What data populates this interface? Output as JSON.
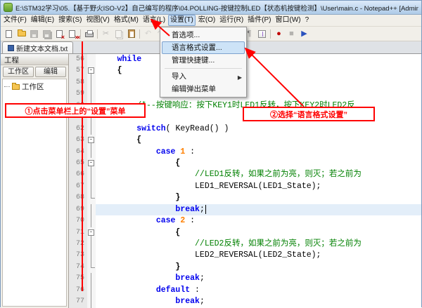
{
  "window": {
    "title": "E:\\STM32学习\\05.【基于野火ISO-V2】自己编写的程序\\04.POLLING-按键控制LED【状态机按键检测】\\User\\main.c - Notepad++ [Administrator]"
  },
  "menu_bar": {
    "active_index": 6,
    "items": [
      "文件(F)",
      "编辑(E)",
      "搜索(S)",
      "视图(V)",
      "格式(M)",
      "语言(L)",
      "设置(T)",
      "宏(O)",
      "运行(R)",
      "插件(P)",
      "窗口(W)",
      "?"
    ]
  },
  "toolbar": {
    "icons": [
      {
        "name": "new-file-icon",
        "cls": "ic-page"
      },
      {
        "name": "open-folder-icon",
        "cls": "ic-folder"
      },
      {
        "name": "save-icon",
        "cls": "ic-floppy",
        "disabled": true
      },
      {
        "name": "save-all-icon",
        "cls": "ic-floppy ic-floppy2",
        "disabled": true
      },
      {
        "name": "close-icon",
        "cls": "ic-page ic-pagex"
      },
      {
        "name": "close-all-icon",
        "cls": "ic-page ic-pagex2"
      },
      {
        "name": "toolbar-separator"
      },
      {
        "name": "print-icon",
        "cls": "ic-print"
      },
      {
        "name": "toolbar-separator"
      },
      {
        "name": "cut-icon",
        "glyph": "✂",
        "color": "#555555",
        "disabled": true
      },
      {
        "name": "copy-icon",
        "cls": "ic-page ic-pages",
        "disabled": true
      },
      {
        "name": "paste-icon",
        "cls": "ic-paste"
      },
      {
        "name": "toolbar-separator"
      },
      {
        "name": "undo-icon",
        "glyph": "↶",
        "color": "#C8A000",
        "disabled": true
      },
      {
        "name": "redo-icon",
        "glyph": "↷",
        "color": "#8A8A8A",
        "disabled": true
      },
      {
        "name": "toolbar-separator"
      },
      {
        "name": "find-icon",
        "cls": "ic-mag"
      },
      {
        "name": "replace-icon",
        "cls": "ic-mag rep"
      },
      {
        "name": "toolbar-separator"
      },
      {
        "name": "zoom-in-icon",
        "cls": "ic-mag plus"
      },
      {
        "name": "zoom-out-icon",
        "cls": "ic-mag minus"
      },
      {
        "name": "toolbar-separator"
      },
      {
        "name": "word-wrap-icon",
        "glyph": "¶",
        "color": "#2A52BE"
      },
      {
        "name": "show-all-chars-icon",
        "glyph": "¶",
        "color": "#888888"
      },
      {
        "name": "indent-guide-icon",
        "cls": "ic-guide"
      },
      {
        "name": "toolbar-separator"
      },
      {
        "name": "record-macro-icon",
        "glyph": "●",
        "color": "#C00000"
      },
      {
        "name": "stop-macro-icon",
        "glyph": "■",
        "color": "#444444",
        "disabled": true
      },
      {
        "name": "play-macro-icon",
        "glyph": "▶",
        "color": "#2A52BE"
      }
    ]
  },
  "tab_bar": {
    "tabs": [
      {
        "label": "新建文本文档.txt"
      }
    ]
  },
  "project_panel": {
    "title": "工程",
    "workspace_button": "工作区",
    "edit_button": "编辑",
    "tree_root": "工作区"
  },
  "settings_menu": {
    "items": [
      {
        "label": "首选项..."
      },
      {
        "label": "语言格式设置...",
        "selected": true
      },
      {
        "label": "管理快捷键..."
      },
      {
        "separator": true
      },
      {
        "label": "导入",
        "submenu": true
      },
      {
        "label": "编辑弹出菜单"
      }
    ]
  },
  "editor": {
    "lines": [
      {
        "num": 56,
        "fold": "none",
        "segs": [
          {
            "t": "    "
          },
          {
            "t": "while",
            "c": "kw"
          }
        ]
      },
      {
        "num": 57,
        "fold": "box",
        "segs": [
          {
            "t": "    "
          },
          {
            "t": "{",
            "c": "op"
          }
        ]
      },
      {
        "num": 58,
        "fold": "line",
        "segs": []
      },
      {
        "num": 59,
        "fold": "line",
        "segs": []
      },
      {
        "num": 60,
        "fold": "line",
        "segs": [
          {
            "t": "        "
          },
          {
            "t": "/*--按键响应：按下KEY1时LED1反转，按下KEY2时LED2反",
            "c": "cm"
          }
        ]
      },
      {
        "num": 61,
        "fold": "line",
        "segs": []
      },
      {
        "num": 62,
        "fold": "line",
        "segs": [
          {
            "t": "        "
          },
          {
            "t": "switch",
            "c": "kw"
          },
          {
            "t": "( KeyRead() )"
          }
        ]
      },
      {
        "num": 63,
        "fold": "box",
        "segs": [
          {
            "t": "        "
          },
          {
            "t": "{",
            "c": "op"
          }
        ]
      },
      {
        "num": 64,
        "fold": "line",
        "segs": [
          {
            "t": "            "
          },
          {
            "t": "case",
            "c": "kw"
          },
          {
            "t": " "
          },
          {
            "t": "1",
            "c": "nm"
          },
          {
            "t": " :"
          }
        ]
      },
      {
        "num": 65,
        "fold": "box",
        "segs": [
          {
            "t": "                "
          },
          {
            "t": "{",
            "c": "op"
          }
        ]
      },
      {
        "num": 66,
        "fold": "line",
        "segs": [
          {
            "t": "                    "
          },
          {
            "t": "//LED1反转，如果之前为亮，则灭；若之前为",
            "c": "cm"
          }
        ]
      },
      {
        "num": 67,
        "fold": "line",
        "segs": [
          {
            "t": "                    LED1_REVERSAL(LED1_State);"
          }
        ]
      },
      {
        "num": 68,
        "fold": "end",
        "segs": [
          {
            "t": "                "
          },
          {
            "t": "}",
            "c": "op"
          }
        ]
      },
      {
        "num": 69,
        "fold": "line",
        "current": true,
        "cursor": true,
        "segs": [
          {
            "t": "                "
          },
          {
            "t": "break",
            "c": "kw"
          },
          {
            "t": ";"
          }
        ]
      },
      {
        "num": 70,
        "fold": "line",
        "segs": [
          {
            "t": "            "
          },
          {
            "t": "case",
            "c": "kw"
          },
          {
            "t": " "
          },
          {
            "t": "2",
            "c": "nm"
          },
          {
            "t": " :"
          }
        ]
      },
      {
        "num": 71,
        "fold": "box",
        "segs": [
          {
            "t": "                "
          },
          {
            "t": "{",
            "c": "op"
          }
        ]
      },
      {
        "num": 72,
        "fold": "line",
        "segs": [
          {
            "t": "                    "
          },
          {
            "t": "//LED2反转，如果之前为亮，则灭；若之前为",
            "c": "cm"
          }
        ]
      },
      {
        "num": 73,
        "fold": "line",
        "segs": [
          {
            "t": "                    LED2_REVERSAL(LED2_State);"
          }
        ]
      },
      {
        "num": 74,
        "fold": "end",
        "segs": [
          {
            "t": "                "
          },
          {
            "t": "}",
            "c": "op"
          }
        ]
      },
      {
        "num": 75,
        "fold": "line",
        "segs": [
          {
            "t": "                "
          },
          {
            "t": "break",
            "c": "kw"
          },
          {
            "t": ";"
          }
        ]
      },
      {
        "num": 76,
        "fold": "line",
        "segs": [
          {
            "t": "            "
          },
          {
            "t": "default",
            "c": "kw"
          },
          {
            "t": " :"
          }
        ]
      },
      {
        "num": 77,
        "fold": "line",
        "segs": [
          {
            "t": "                "
          },
          {
            "t": "break",
            "c": "kw"
          },
          {
            "t": ";"
          }
        ]
      }
    ]
  },
  "annotations": {
    "callout1": "①点击菜单栏上的“设置”菜单",
    "callout2": "②选择“语言格式设置”",
    "color": "#ff0000"
  }
}
